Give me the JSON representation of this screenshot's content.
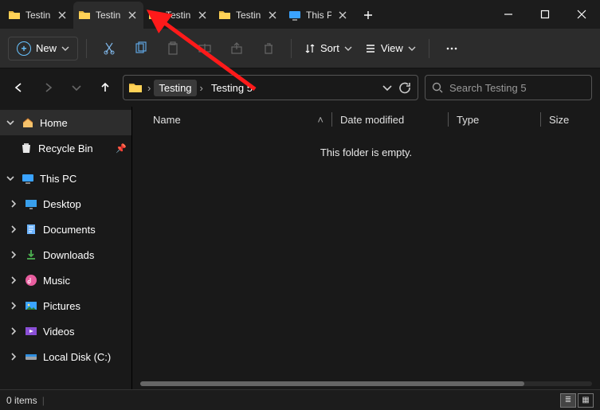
{
  "tabs": [
    {
      "label": "Testin",
      "icon": "folder"
    },
    {
      "label": "Testin",
      "icon": "folder"
    },
    {
      "label": "Testin",
      "icon": "folder"
    },
    {
      "label": "Testin",
      "icon": "folder"
    },
    {
      "label": "This P",
      "icon": "pc"
    }
  ],
  "active_tab_index": 1,
  "toolbar": {
    "new_label": "New",
    "sort_label": "Sort",
    "view_label": "View"
  },
  "breadcrumbs": [
    "Testing",
    "Testing 5"
  ],
  "search": {
    "placeholder": "Search Testing 5"
  },
  "sidebar": {
    "home": "Home",
    "recycle": "Recycle Bin",
    "thispc": "This PC",
    "desktop": "Desktop",
    "documents": "Documents",
    "downloads": "Downloads",
    "music": "Music",
    "pictures": "Pictures",
    "videos": "Videos",
    "localdisk": "Local Disk (C:)"
  },
  "columns": {
    "name": "Name",
    "date": "Date modified",
    "type": "Type",
    "size": "Size"
  },
  "empty_text": "This folder is empty.",
  "status": {
    "count": "0 items"
  }
}
